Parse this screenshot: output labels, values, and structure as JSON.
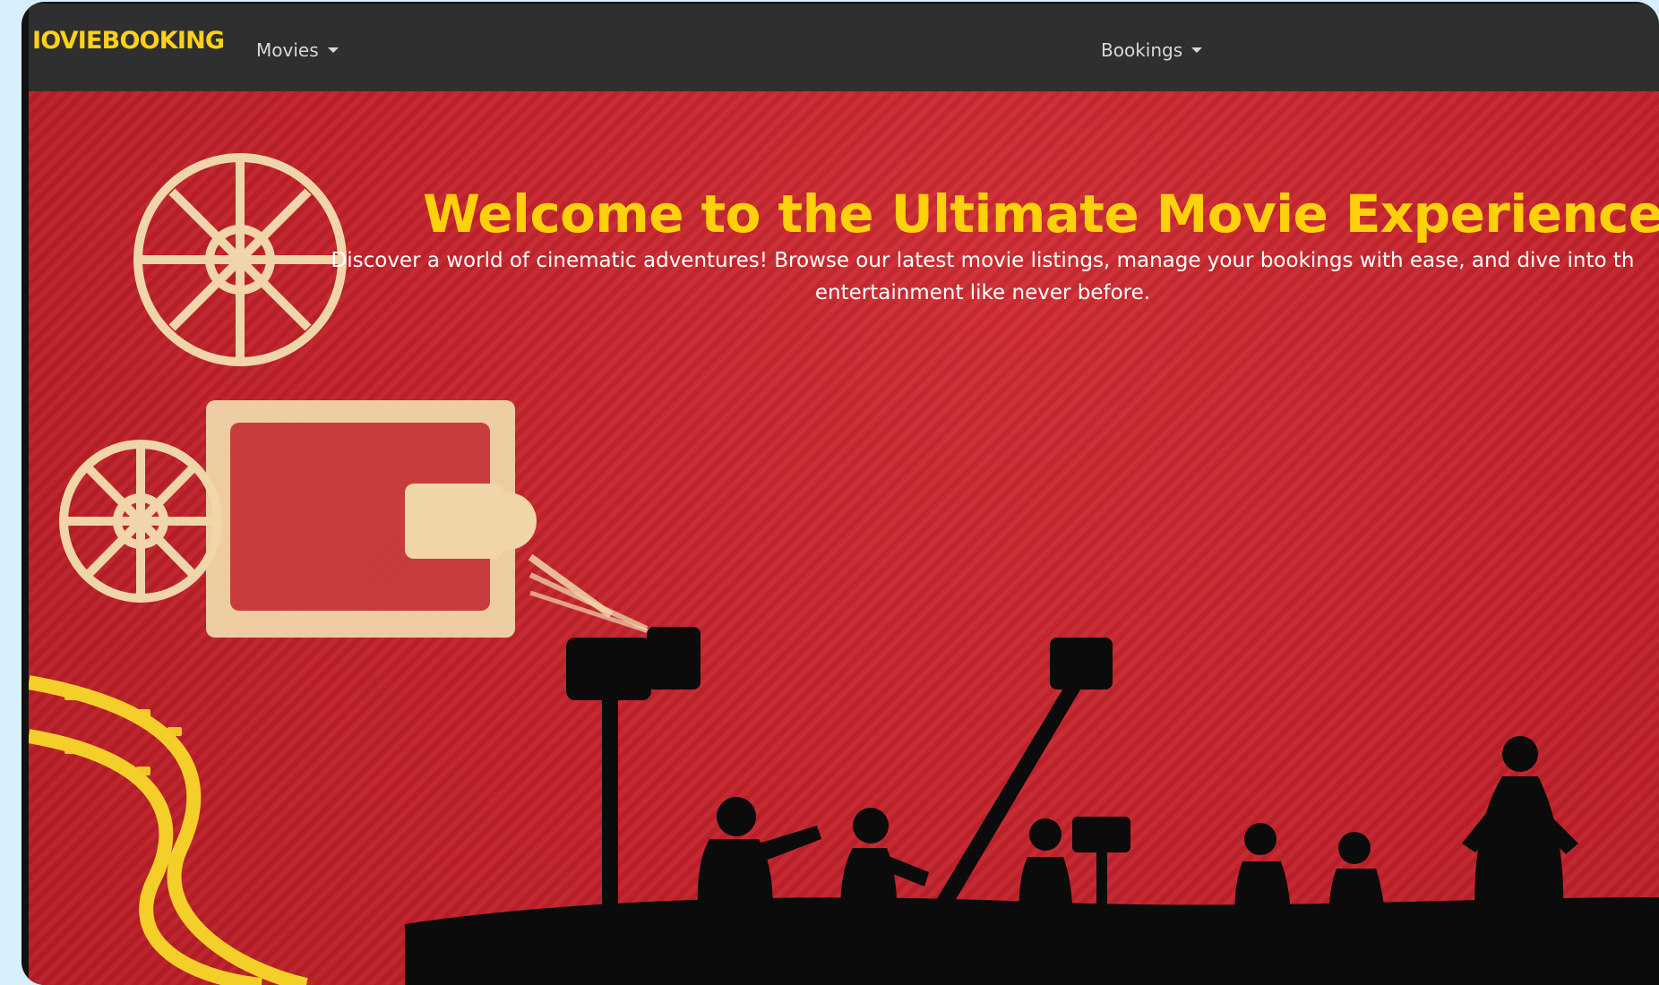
{
  "navbar": {
    "brand": "IOVIEBOOKING",
    "menu": [
      {
        "label": "Movies",
        "icon": "caret-down-icon"
      },
      {
        "label": "Bookings",
        "icon": "caret-down-icon"
      }
    ]
  },
  "hero": {
    "title": "Welcome to the Ultimate Movie Experience!",
    "subtitle_line1": "Discover a world of cinematic adventures! Browse our latest movie listings, manage your bookings with ease, and dive into th",
    "subtitle_line2": "entertainment like never before."
  },
  "colors": {
    "brand": "#ffd11a",
    "navbar": "#2f2f2f",
    "hero_bg": "#c4242c",
    "illustration": "#f3dfb0"
  }
}
